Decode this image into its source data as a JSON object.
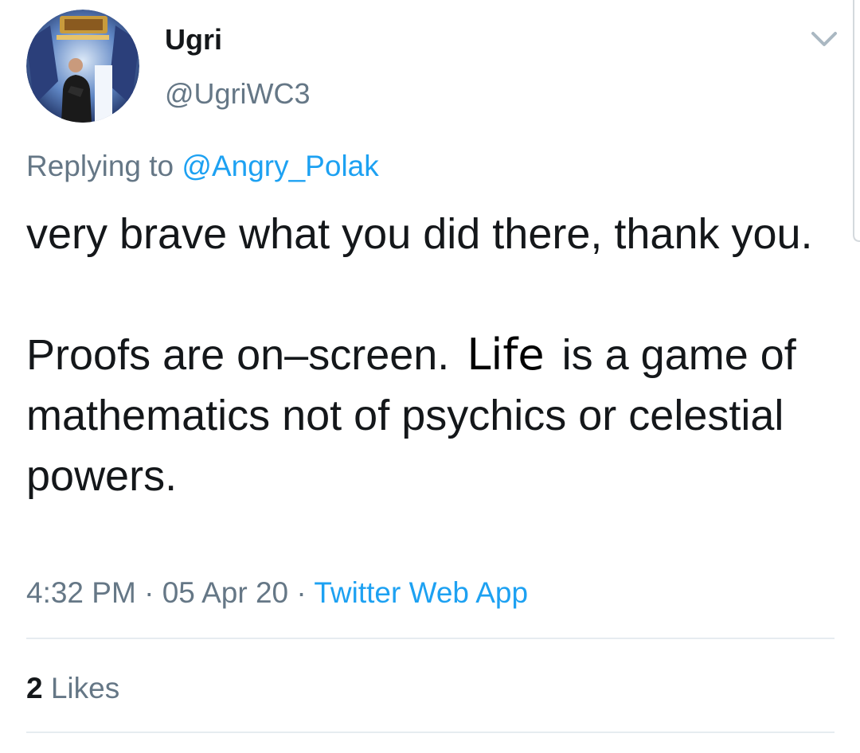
{
  "author": {
    "display_name": "Ugri",
    "handle": "@UgriWC3"
  },
  "reply": {
    "prefix": "Replying to",
    "mention": "@Angry_Polak"
  },
  "tweet": {
    "line1": "very brave what you did there, thank you.",
    "line2_before": "Proofs are on–screen.",
    "line2_inserted_word": "Life",
    "line2_after": "is a game of mathematics not of psychics or celestial powers."
  },
  "meta": {
    "time": "4:32 PM",
    "separator": "·",
    "date": "05 Apr 20",
    "source": "Twitter Web App"
  },
  "stats": {
    "likes_count": "2",
    "likes_label": "Likes"
  },
  "icons": {
    "more": "chevron-down-icon",
    "avatar": "avatar-photo"
  },
  "colors": {
    "text": "#14171a",
    "secondary": "#657786",
    "link": "#1da1f2",
    "divider": "#e6ecf0"
  }
}
